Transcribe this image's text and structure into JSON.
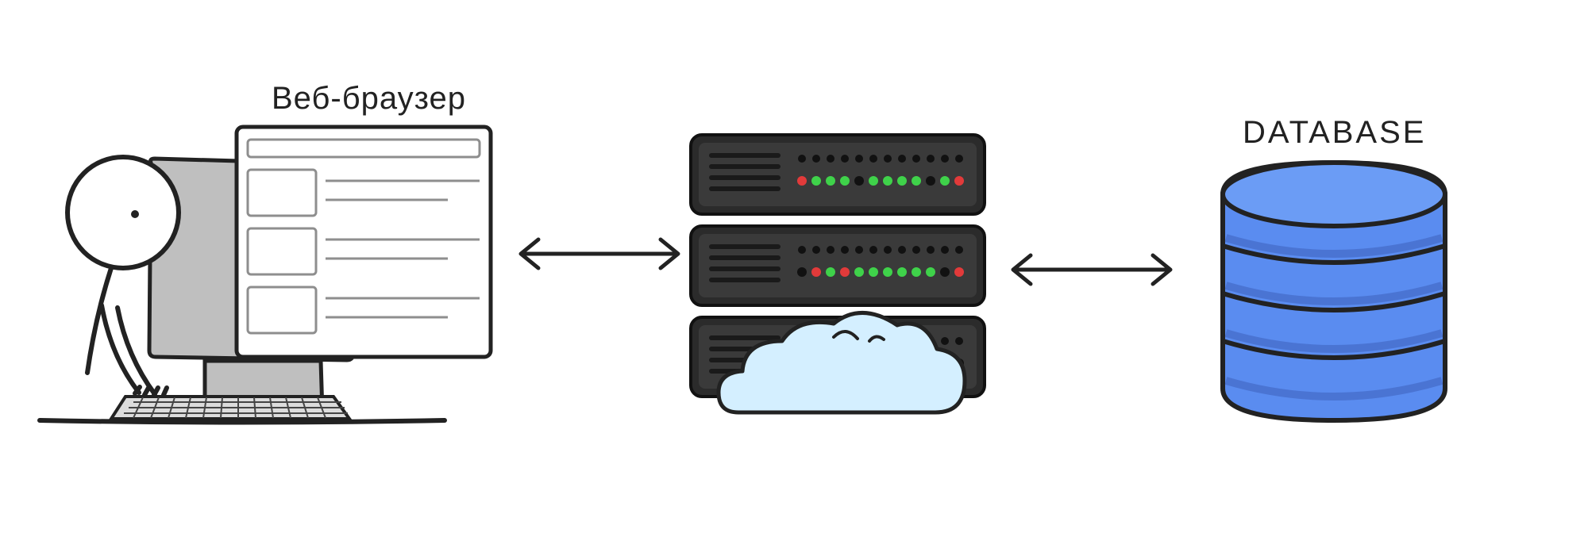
{
  "labels": {
    "browser": "Веб-браузер",
    "database": "DATABASE"
  },
  "icons": {
    "person": "person-icon",
    "monitor": "monitor-icon",
    "keyboard": "keyboard-icon",
    "browser_window": "browser-window-icon",
    "server": "server-rack-icon",
    "cloud": "cloud-icon",
    "database": "database-cylinder-icon",
    "arrow_left": "double-arrow-icon",
    "arrow_right": "double-arrow-icon"
  },
  "colors": {
    "ink": "#222222",
    "monitor_fill": "#bfbfbf",
    "browser_fill": "#ffffff",
    "browser_lines": "#8e8e8e",
    "server_body": "#3a3a3a",
    "server_dark": "#2b2b2b",
    "server_slot": "#555555",
    "led_green": "#3fd24a",
    "led_red": "#e23a3a",
    "cloud_fill": "#d4efff",
    "db_fill": "#5a8cf0",
    "db_edge": "#2f4aa0"
  }
}
